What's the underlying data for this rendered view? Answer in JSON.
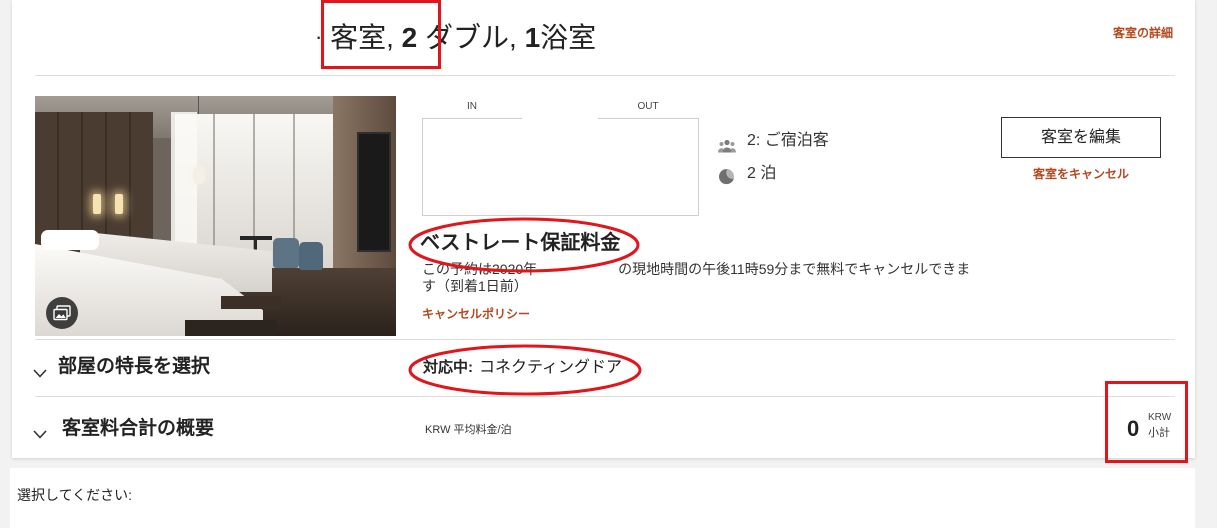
{
  "title": {
    "bullet": "·",
    "room": " 客室, ",
    "bed_count": "2",
    "bed_type": " ダブル, ",
    "bath_count": "1",
    "bath": "浴室"
  },
  "room_details_link": "客室の詳細",
  "dates": {
    "in_label": "IN",
    "out_label": "OUT"
  },
  "stay": {
    "guests": "2: ご宿泊客",
    "nights": "2 泊"
  },
  "actions": {
    "edit_room": "客室を編集",
    "cancel_room": "客室をキャンセル"
  },
  "rate": {
    "name": "ベストレート保証料金",
    "policy_before": "この予約は2020年",
    "policy_after": "の現地時間の午後11時59分まで無料でキャンセルできます（到着1日前）",
    "policy_link": "キャンセルポリシー"
  },
  "features": {
    "label": "部屋の特長を選択",
    "status_label": "対応中:",
    "status_value": "コネクティングドア"
  },
  "summary": {
    "label": "客室料合計の概要",
    "avg_rate_label": "KRW 平均料金/泊",
    "subtotal_value": "0",
    "currency": "KRW",
    "subtotal_label": "小計"
  },
  "footer": {
    "prompt": "選択してください:"
  },
  "icons": {
    "gallery": "photo-gallery-icon",
    "guests": "guests-icon",
    "nights": "moon-icon",
    "expand": "chevron-down-icon"
  },
  "colors": {
    "link": "#b4491f",
    "annotation": "#e0161c",
    "text": "#222222",
    "divider": "#dedede"
  }
}
